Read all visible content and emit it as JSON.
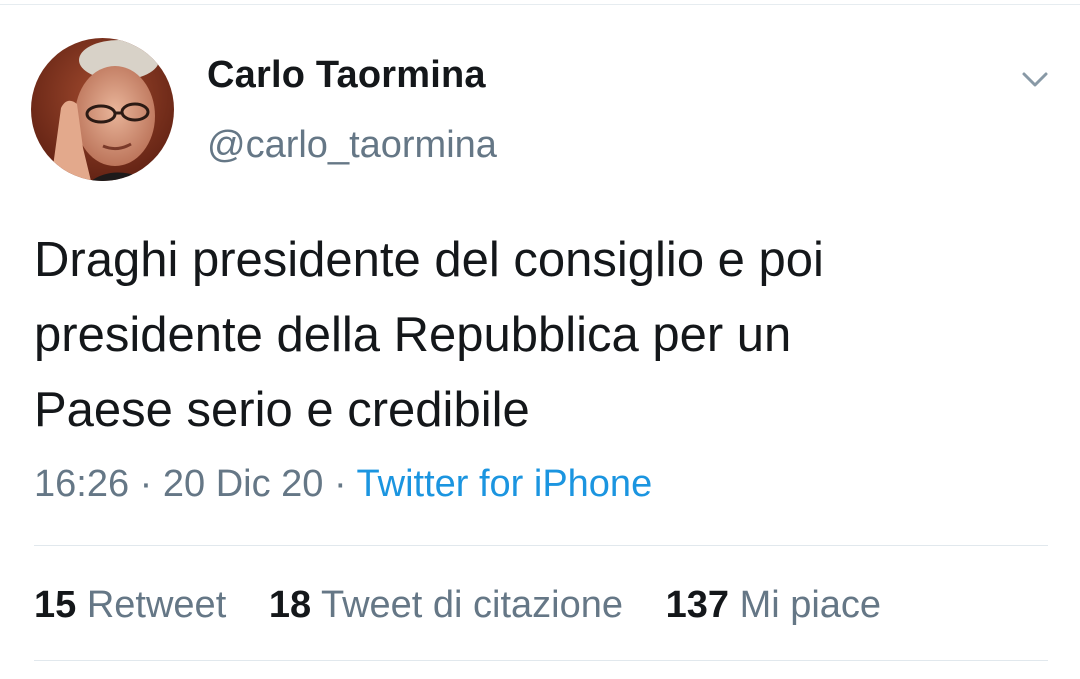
{
  "tweet": {
    "author": {
      "display_name": "Carlo Taormina",
      "handle": "@carlo_taormina",
      "avatar_icon": "profile-photo"
    },
    "text": "Draghi presidente del consiglio e poi\npresidente della Repubblica per un\nPaese serio e credibile",
    "time": "16:26",
    "date": "20 Dic 20",
    "separator": "·",
    "source": "Twitter for iPhone",
    "menu_icon": "chevron-down-icon"
  },
  "stats": {
    "retweets": {
      "count": "15",
      "label": "Retweet"
    },
    "quotes": {
      "count": "18",
      "label": "Tweet di citazione"
    },
    "likes": {
      "count": "137",
      "label": "Mi piace"
    }
  },
  "colors": {
    "text": "#14171a",
    "secondary": "#657786",
    "link": "#1b95e0",
    "divider": "#e1e8ed"
  }
}
